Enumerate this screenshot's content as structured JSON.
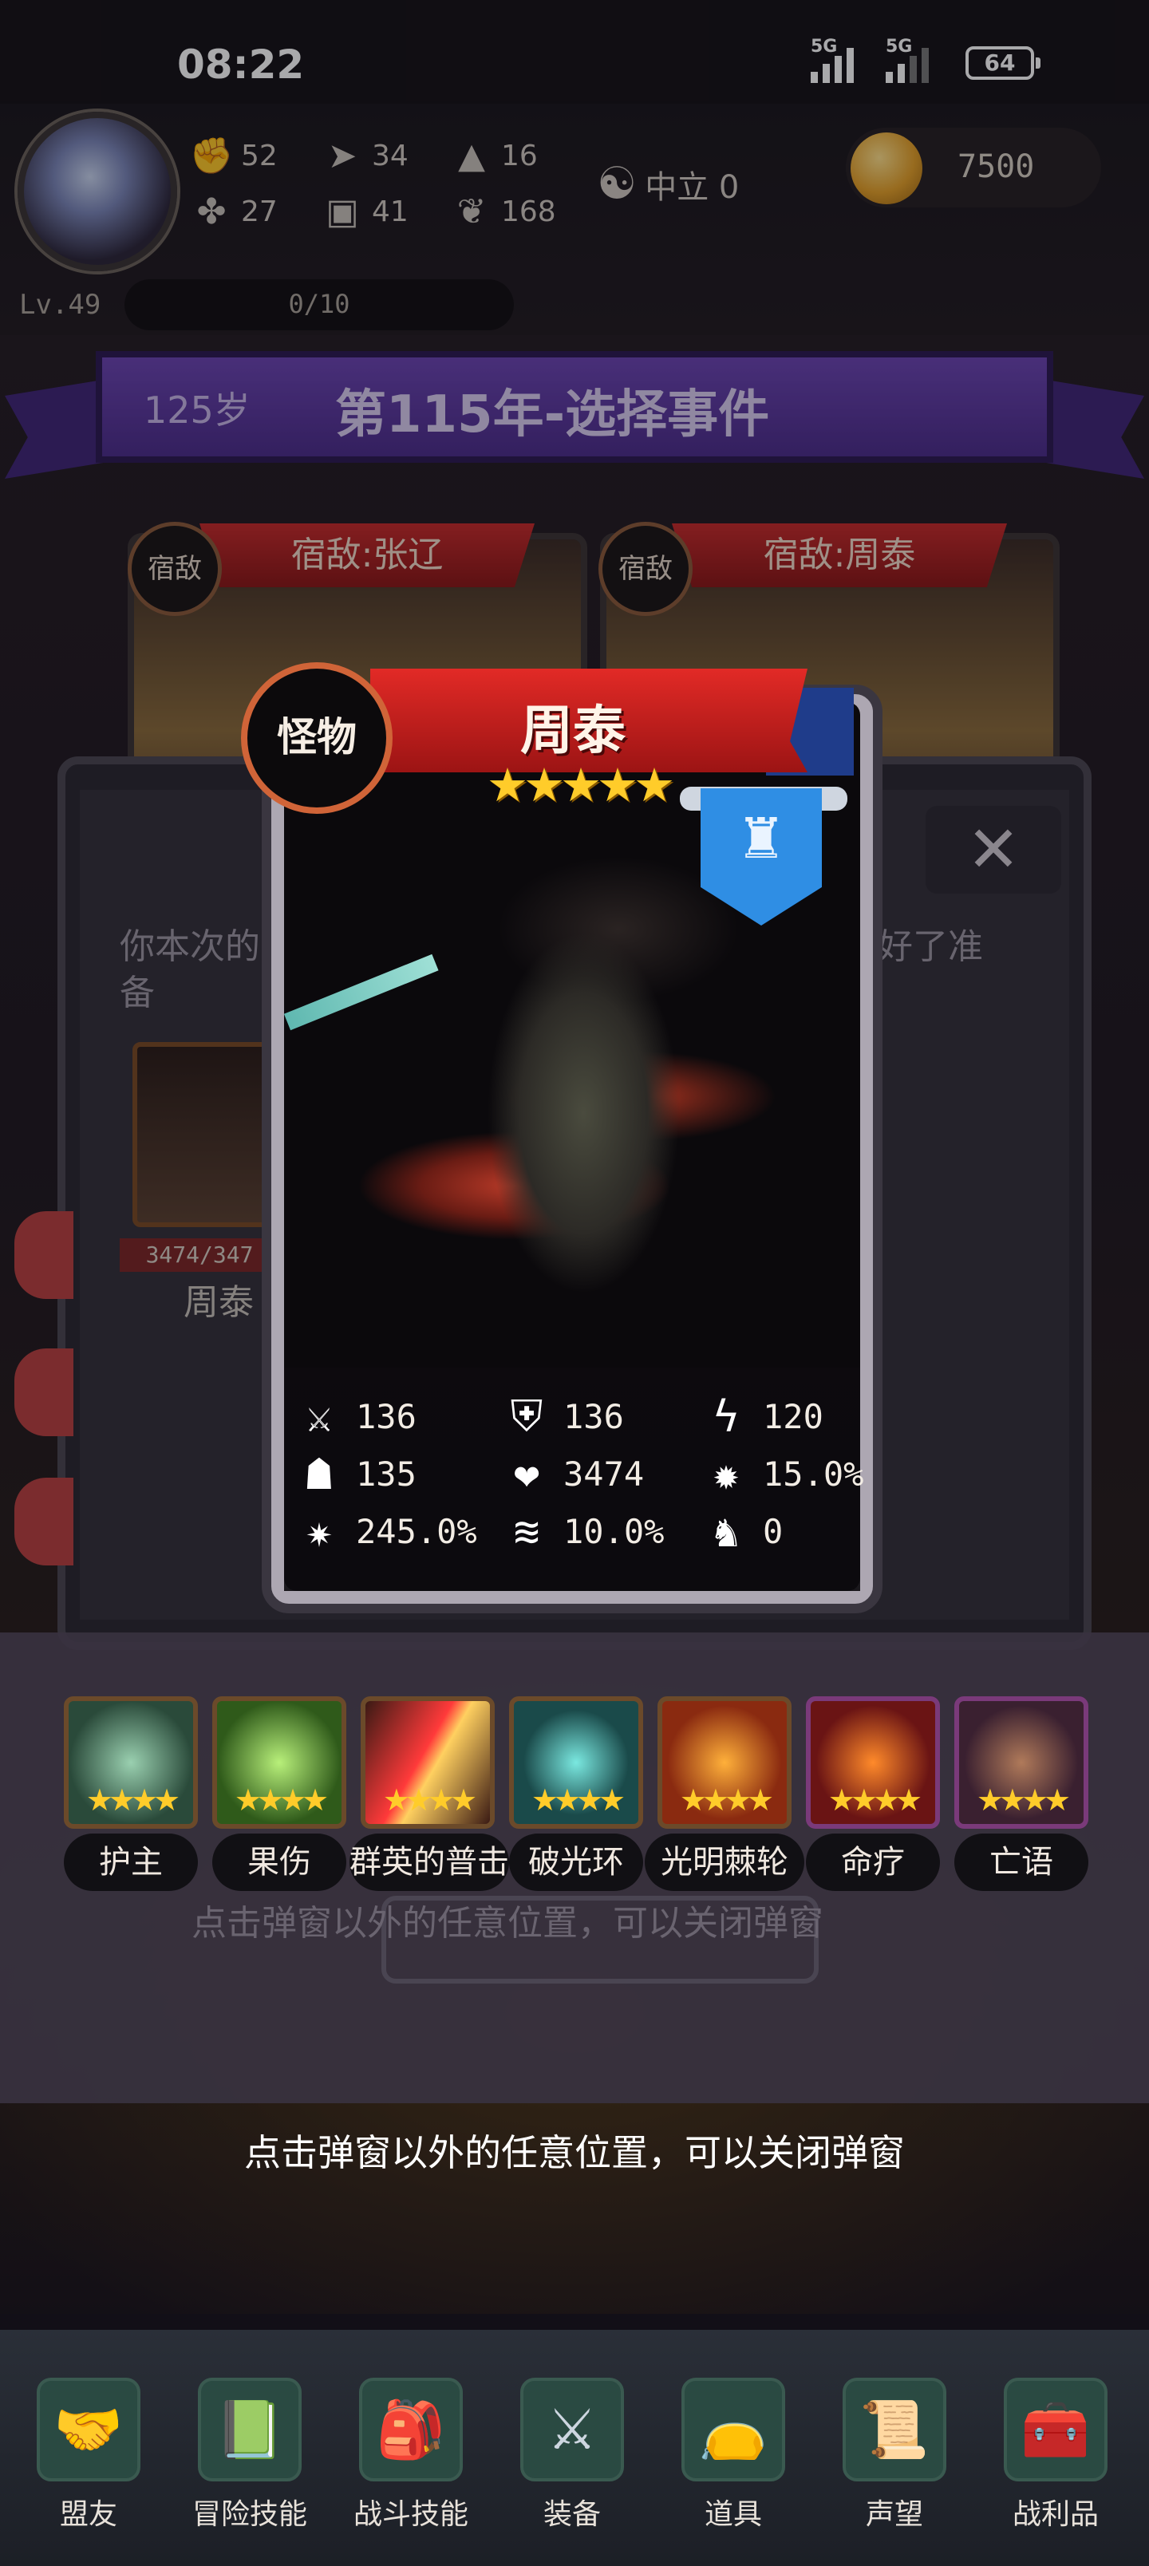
{
  "status": {
    "time": "08:22",
    "net1": "5G",
    "net2": "5G",
    "battery": "64"
  },
  "hud": {
    "stats": [
      {
        "icon": "fist-icon",
        "glyph": "✊",
        "value": "52"
      },
      {
        "icon": "boot-icon",
        "glyph": "➤",
        "value": "34"
      },
      {
        "icon": "hat-icon",
        "glyph": "▲",
        "value": "16"
      },
      {
        "icon": "clover-icon",
        "glyph": "✤",
        "value": "27"
      },
      {
        "icon": "armor-icon",
        "glyph": "▣",
        "value": "41"
      },
      {
        "icon": "leaf-icon",
        "glyph": "❦",
        "value": "168"
      }
    ],
    "alignment": "中立 0",
    "gold": "7500",
    "level": "Lv.49",
    "exp": "0/10"
  },
  "banner": {
    "age": "125岁",
    "title": "第115年-选择事件"
  },
  "rivals": [
    {
      "tag": "宿敌",
      "label": "宿敌:张辽"
    },
    {
      "tag": "宿敌",
      "label": "宿敌:周泰"
    }
  ],
  "back_panel": {
    "text_left": "你本次的",
    "text_left2": "备",
    "text_right": "好了准",
    "hp": "3474/347",
    "boss": "周泰",
    "close": "✕"
  },
  "card": {
    "type": "怪物",
    "name": "周泰",
    "stars": "★★★★★",
    "badge_icon": "crown-shield-icon",
    "stats": [
      {
        "icon": "sword-icon",
        "glyph": "⚔",
        "value": "136"
      },
      {
        "icon": "shield-icon",
        "glyph": "⛨",
        "value": "136"
      },
      {
        "icon": "speed-icon",
        "glyph": "ϟ",
        "value": "120"
      },
      {
        "icon": "hood-icon",
        "glyph": "☗",
        "value": "135"
      },
      {
        "icon": "heart-icon",
        "glyph": "❤",
        "value": "3474"
      },
      {
        "icon": "burst-icon",
        "glyph": "✹",
        "value": "15.0%"
      },
      {
        "icon": "crit-icon",
        "glyph": "✷",
        "value": "245.0%"
      },
      {
        "icon": "tornado-icon",
        "glyph": "≋",
        "value": "10.0%"
      },
      {
        "icon": "winged-boot-icon",
        "glyph": "♞",
        "value": "0"
      }
    ]
  },
  "skills": [
    {
      "name": "护主",
      "color": "#3a6a5a"
    },
    {
      "name": "果伤",
      "color": "#3f7a2a"
    },
    {
      "name": "群英的普击",
      "color": "#7a2a1a"
    },
    {
      "name": "破光环",
      "color": "#2a6a6a"
    },
    {
      "name": "光明棘轮",
      "color": "#8a3a10"
    },
    {
      "name": "命疗",
      "color": "#6a1a1a"
    },
    {
      "name": "亡语",
      "color": "#4a2a40"
    }
  ],
  "skill_stars": "★★★★",
  "ghost_text": "点击弹窗以外的任意位置，可以关闭弹窗",
  "hint": "点击弹窗以外的任意位置，可以关闭弹窗",
  "nav": [
    {
      "label": "盟友",
      "icon": "handshake-icon",
      "glyph": "🤝"
    },
    {
      "label": "冒险技能",
      "icon": "book-icon",
      "glyph": "📗"
    },
    {
      "label": "战斗技能",
      "icon": "backpack-icon",
      "glyph": "🎒"
    },
    {
      "label": "装备",
      "icon": "swords-icon",
      "glyph": "⚔"
    },
    {
      "label": "道具",
      "icon": "pouch-icon",
      "glyph": "👝"
    },
    {
      "label": "声望",
      "icon": "scroll-icon",
      "glyph": "📜"
    },
    {
      "label": "战利品",
      "icon": "chest-icon",
      "glyph": "🧰"
    }
  ]
}
